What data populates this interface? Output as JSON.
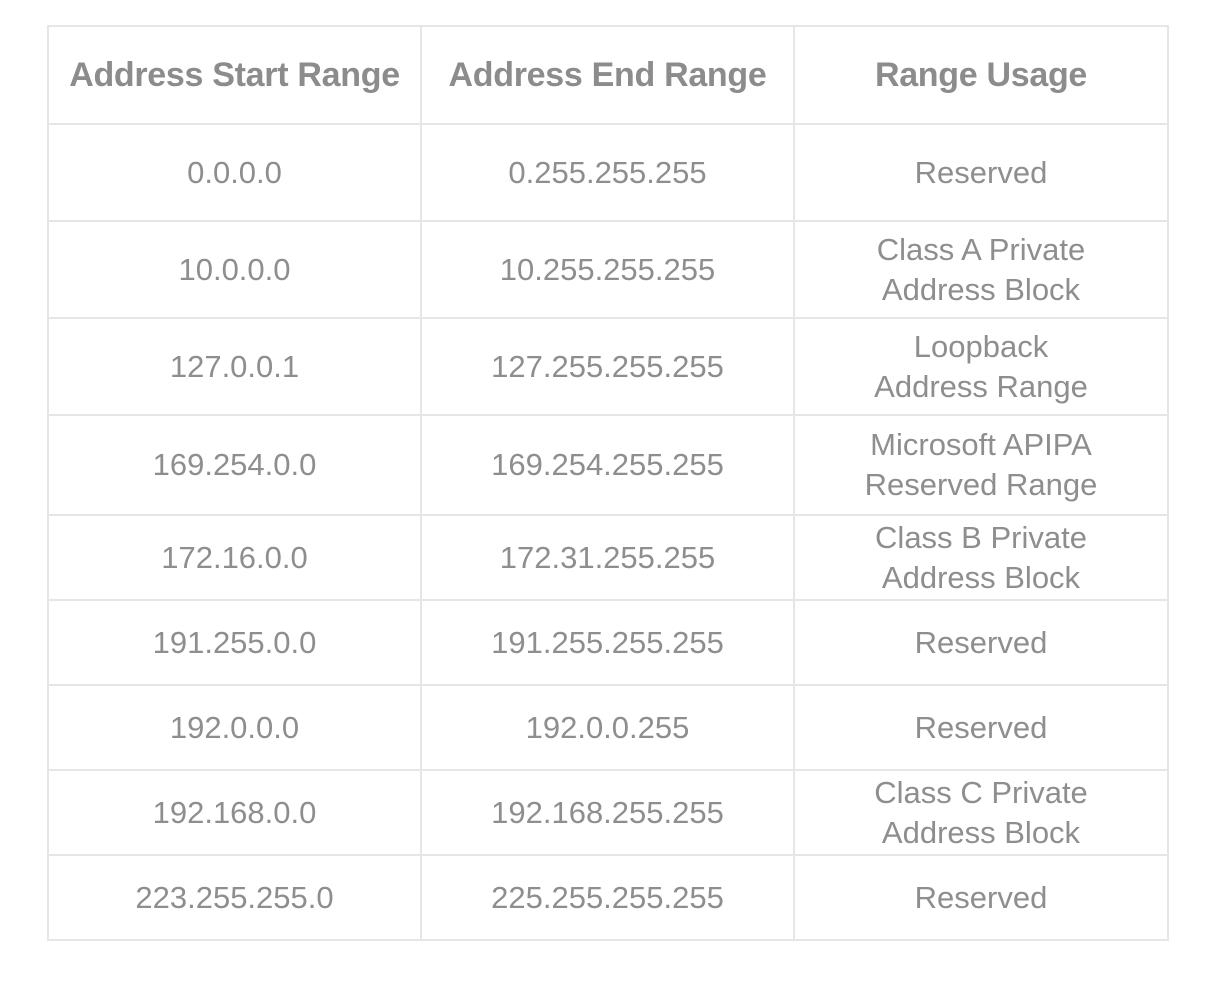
{
  "table": {
    "headers": [
      "Address Start Range",
      "Address End Range",
      "Range Usage"
    ],
    "rows": [
      {
        "start": "0.0.0.0",
        "end": "0.255.255.255",
        "usage": "Reserved"
      },
      {
        "start": "10.0.0.0",
        "end": "10.255.255.255",
        "usage": "Class A Private Address Block"
      },
      {
        "start": "127.0.0.1",
        "end": "127.255.255.255",
        "usage": "Loopback Address Range"
      },
      {
        "start": "169.254.0.0",
        "end": "169.254.255.255",
        "usage": "Microsoft APIPA Reserved Range"
      },
      {
        "start": "172.16.0.0",
        "end": "172.31.255.255",
        "usage": "Class B Private Address Block"
      },
      {
        "start": "191.255.0.0",
        "end": "191.255.255.255",
        "usage": "Reserved"
      },
      {
        "start": "192.0.0.0",
        "end": "192.0.0.255",
        "usage": "Reserved"
      },
      {
        "start": "192.168.0.0",
        "end": "192.168.255.255",
        "usage": "Class C Private Address Block"
      },
      {
        "start": "223.255.255.0",
        "end": "225.255.255.255",
        "usage": "Reserved"
      }
    ]
  },
  "colors": {
    "border": "#e6e6e6",
    "text": "#8a8a8a",
    "background": "#ffffff"
  }
}
